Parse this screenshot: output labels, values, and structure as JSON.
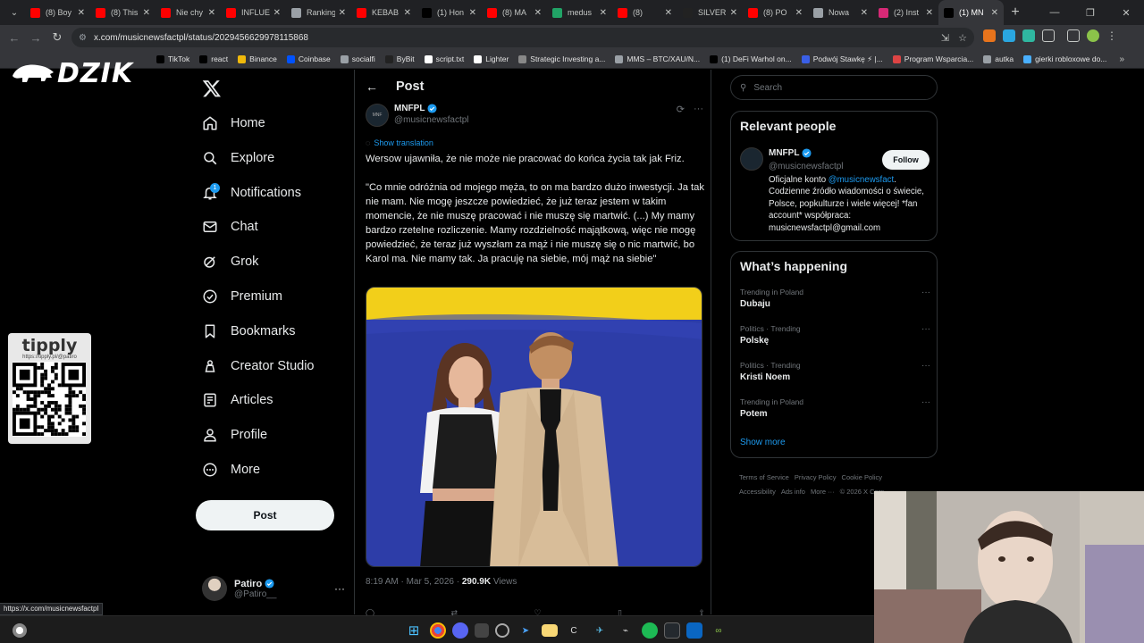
{
  "browser": {
    "tabs": [
      {
        "label": "(8) Boy",
        "color": "#ff0000",
        "icon": "youtube-icon"
      },
      {
        "label": "(8) This",
        "color": "#ff0000",
        "icon": "youtube-icon"
      },
      {
        "label": "Nie chy",
        "color": "#ff0000",
        "icon": "youtube-icon"
      },
      {
        "label": "INFLUE",
        "color": "#ff0000",
        "icon": "youtube-icon"
      },
      {
        "label": "Ranking",
        "color": "#9aa0a6",
        "icon": "globe-icon"
      },
      {
        "label": "KEBAB",
        "color": "#ff0000",
        "icon": "youtube-icon"
      },
      {
        "label": "(1) Hon",
        "color": "#000000",
        "icon": "x-icon"
      },
      {
        "label": "(8) MA",
        "color": "#ff0000",
        "icon": "youtube-icon"
      },
      {
        "label": "medus",
        "color": "#21a366",
        "icon": "kick-icon"
      },
      {
        "label": "(8)",
        "color": "#ff0000",
        "icon": "youtube-icon"
      },
      {
        "label": "SILVER",
        "color": "#222222",
        "icon": "tradingview-icon"
      },
      {
        "label": "(8) PO",
        "color": "#ff0000",
        "icon": "youtube-icon"
      },
      {
        "label": "Nowa",
        "color": "#9aa0a6",
        "icon": "globe-icon"
      },
      {
        "label": "(2) Inst",
        "color": "#d62976",
        "icon": "instagram-icon"
      },
      {
        "label": "(1) MN",
        "color": "#000000",
        "icon": "x-icon",
        "active": true
      }
    ],
    "url": "x.com/musicnewsfactpl/status/2029456629978115868",
    "bookmarks": [
      {
        "label": "TikTok",
        "color": "#000000"
      },
      {
        "label": "react",
        "color": "#000000"
      },
      {
        "label": "Binance",
        "color": "#f0b90b"
      },
      {
        "label": "Coinbase",
        "color": "#0052ff"
      },
      {
        "label": "socialfi",
        "color": "#9aa0a6"
      },
      {
        "label": "ByBit",
        "color": "#222222"
      },
      {
        "label": "script.txt",
        "color": "#ffffff"
      },
      {
        "label": "Lighter",
        "color": "#ffffff"
      },
      {
        "label": "Strategic Investing a...",
        "color": "#888888"
      },
      {
        "label": "MMS – BTC/XAU/N...",
        "color": "#9aa0a6"
      },
      {
        "label": "(1) DeFi Warhol on...",
        "color": "#000000"
      },
      {
        "label": "Podwój Stawkę ⚡ |...",
        "color": "#3a5fe6"
      },
      {
        "label": "Program Wsparcia...",
        "color": "#dd4444"
      },
      {
        "label": "autka",
        "color": "#9aa0a6"
      },
      {
        "label": "gierki robloxowe do...",
        "color": "#4ab0ff"
      }
    ]
  },
  "overlay": {
    "brand": "DZIK",
    "tipply_title": "tipply",
    "tipply_url": "https://tipply.pl/@patiro"
  },
  "nav": {
    "items": [
      {
        "label": "Home",
        "icon": "home-icon"
      },
      {
        "label": "Explore",
        "icon": "search-icon"
      },
      {
        "label": "Notifications",
        "icon": "bell-icon",
        "badge": "1"
      },
      {
        "label": "Chat",
        "icon": "mail-icon"
      },
      {
        "label": "Grok",
        "icon": "grok-icon"
      },
      {
        "label": "Premium",
        "icon": "verified-icon"
      },
      {
        "label": "Bookmarks",
        "icon": "bookmark-icon"
      },
      {
        "label": "Creator Studio",
        "icon": "creator-icon"
      },
      {
        "label": "Articles",
        "icon": "articles-icon"
      },
      {
        "label": "Profile",
        "icon": "person-icon"
      },
      {
        "label": "More",
        "icon": "more-icon"
      }
    ],
    "post_button": "Post",
    "account": {
      "name": "Patiro",
      "handle": "@Patiro__"
    }
  },
  "post": {
    "header": "Post",
    "author_name": "MNFPL",
    "author_handle": "@musicnewsfactpl",
    "show_translation": "Show translation",
    "text": "Wersow ujawniła, że nie może nie pracować do końca życia tak jak Friz.\n\n\"Co mnie odróżnia od mojego męża, to on ma bardzo dużo inwestycji. Ja tak nie mam. Nie mogę jeszcze powiedzieć, że już teraz jestem w takim momencie, że nie muszę pracować i nie muszę się martwić. (...) My mamy bardzo rzetelne rozliczenie. Mamy rozdzielność majątkową, więc nie mogę powiedzieć, że teraz już wyszłam za mąż i nie muszę się o nic martwić, bo Karol ma. Nie mamy tak. Ja pracuję na siebie, mój mąż na siebie\"",
    "time": "8:19 AM · Mar 5, 2026 · ",
    "views": "290.9K",
    "views_label": " Views"
  },
  "sidebar": {
    "search_placeholder": "Search",
    "relevant_title": "Relevant people",
    "person_name": "MNFPL",
    "person_handle": "@musicnewsfactpl",
    "follow": "Follow",
    "bio_pre": "Oficjalne konto ",
    "bio_link": "@musicnewsfact",
    "bio_post": ". Codzienne źródło wiadomości o świecie, Polsce, popkulturze i wiele więcej! *fan account* współpraca: musicnewsfactpl@gmail.com",
    "happening_title": "What’s happening",
    "trends": [
      {
        "context": "Trending in Poland",
        "name": "Dubaju"
      },
      {
        "context": "Politics · Trending",
        "name": "Polskę"
      },
      {
        "context": "Politics · Trending",
        "name": "Kristi Noem"
      },
      {
        "context": "Trending in Poland",
        "name": "Potem"
      }
    ],
    "show_more": "Show more",
    "footer": [
      "Terms of Service",
      "Privacy Policy",
      "Cookie Policy",
      "Accessibility",
      "Ads info",
      "More ···",
      "© 2026 X Corp."
    ]
  },
  "status_url": "https://x.com/musicnewsfactpl",
  "colors": {
    "accent": "#1d9bf0",
    "bg": "#000000",
    "border": "#2f3336"
  }
}
